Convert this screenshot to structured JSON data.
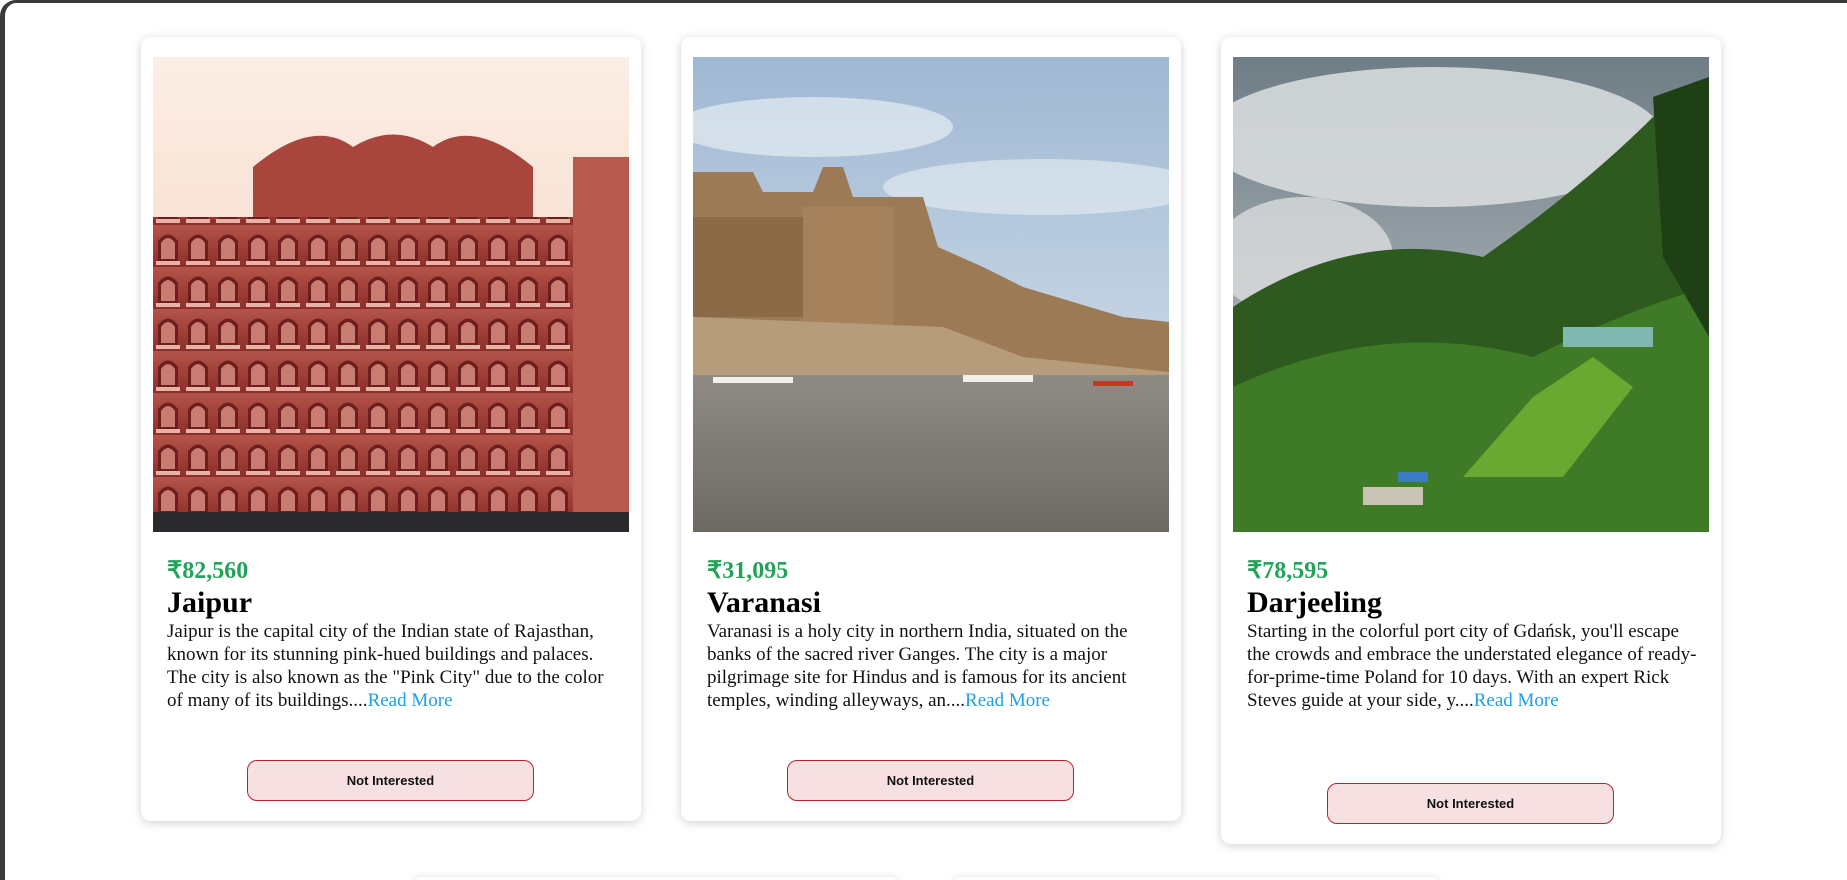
{
  "cards": [
    {
      "price": "₹82,560",
      "name": "Jaipur",
      "description": "Jaipur is the capital city of the Indian state of Rajasthan, known for its stunning pink-hued buildings and palaces. The city is also known as the \"Pink City\" due to the color of many of its buildings....",
      "read_more": "Read More",
      "button": "Not Interested",
      "image_subject": "Hawa Mahal pink palace facade"
    },
    {
      "price": "₹31,095",
      "name": "Varanasi",
      "description": "Varanasi is a holy city in northern India, situated on the banks of the sacred river Ganges. The city is a major pilgrimage site for Hindus and is famous for its ancient temples, winding alleyways, an....",
      "read_more": "Read More",
      "button": "Not Interested",
      "image_subject": "Ghats on the Ganges river"
    },
    {
      "price": "₹78,595",
      "name": "Darjeeling",
      "description": "Starting in the colorful port city of Gdańsk, you'll escape the crowds and embrace the understated elegance of ready-for-prime-time Poland for 10 days. With an expert Rick Steves guide at your side, y....",
      "read_more": "Read More",
      "button": "Not Interested",
      "image_subject": "Misty green hills with tea terraces"
    }
  ],
  "colors": {
    "price": "#23a35a",
    "link": "#1da1e0",
    "button_bg": "#f7e0e2",
    "button_border": "#b3262f"
  }
}
